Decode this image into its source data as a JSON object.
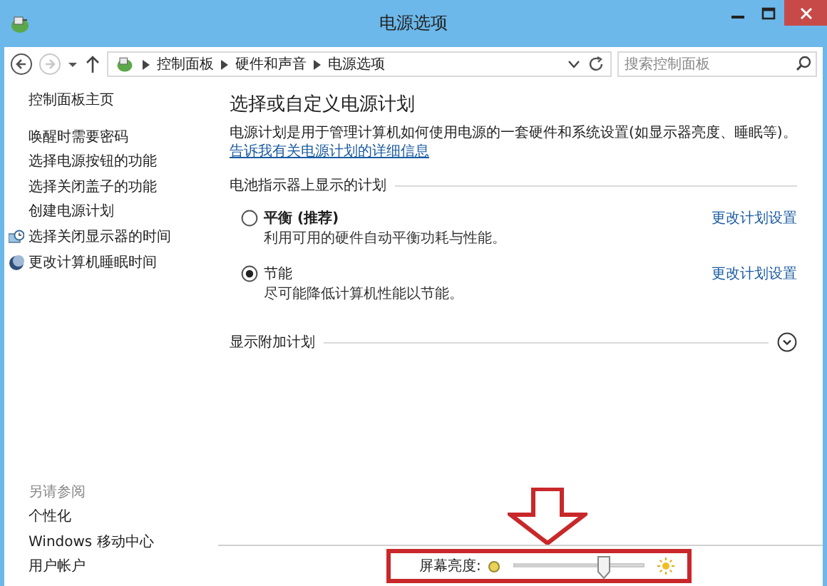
{
  "window": {
    "title": "电源选项"
  },
  "address_bar": {
    "breadcrumbs": [
      "控制面板",
      "硬件和声音",
      "电源选项"
    ],
    "back_disabled": false,
    "forward_disabled": true
  },
  "search": {
    "placeholder": "搜索控制面板"
  },
  "sidebar": {
    "home": "控制面板主页",
    "items": [
      {
        "label": "唤醒时需要密码",
        "has_icon": false
      },
      {
        "label": "选择电源按钮的功能",
        "has_icon": false
      },
      {
        "label": "选择关闭盖子的功能",
        "has_icon": false
      },
      {
        "label": "创建电源计划",
        "has_icon": false
      },
      {
        "label": "选择关闭显示器的时间",
        "has_icon": true
      },
      {
        "label": "更改计算机睡眠时间",
        "has_icon": true
      }
    ],
    "see_also_title": "另请参阅",
    "see_also": [
      "个性化",
      "Windows 移动中心",
      "用户帐户"
    ]
  },
  "main": {
    "heading": "选择或自定义电源计划",
    "description": "电源计划是用于管理计算机如何使用电源的一套硬件和系统设置(如显示器亮度、睡眠等)。",
    "description_link": "告诉我有关电源计划的详细信息",
    "section_title": "电池指示器上显示的计划",
    "plans": [
      {
        "name": "平衡 (推荐)",
        "recommended": true,
        "selected": false,
        "description": "利用可用的硬件自动平衡功耗与性能。",
        "link": "更改计划设置"
      },
      {
        "name": "节能",
        "recommended": false,
        "selected": true,
        "description": "尽可能降低计算机性能以节能。",
        "link": "更改计划设置"
      }
    ],
    "more_plans": "显示附加计划",
    "more_expanded": false
  },
  "brightness": {
    "label": "屏幕亮度:",
    "level": 0.68
  }
}
